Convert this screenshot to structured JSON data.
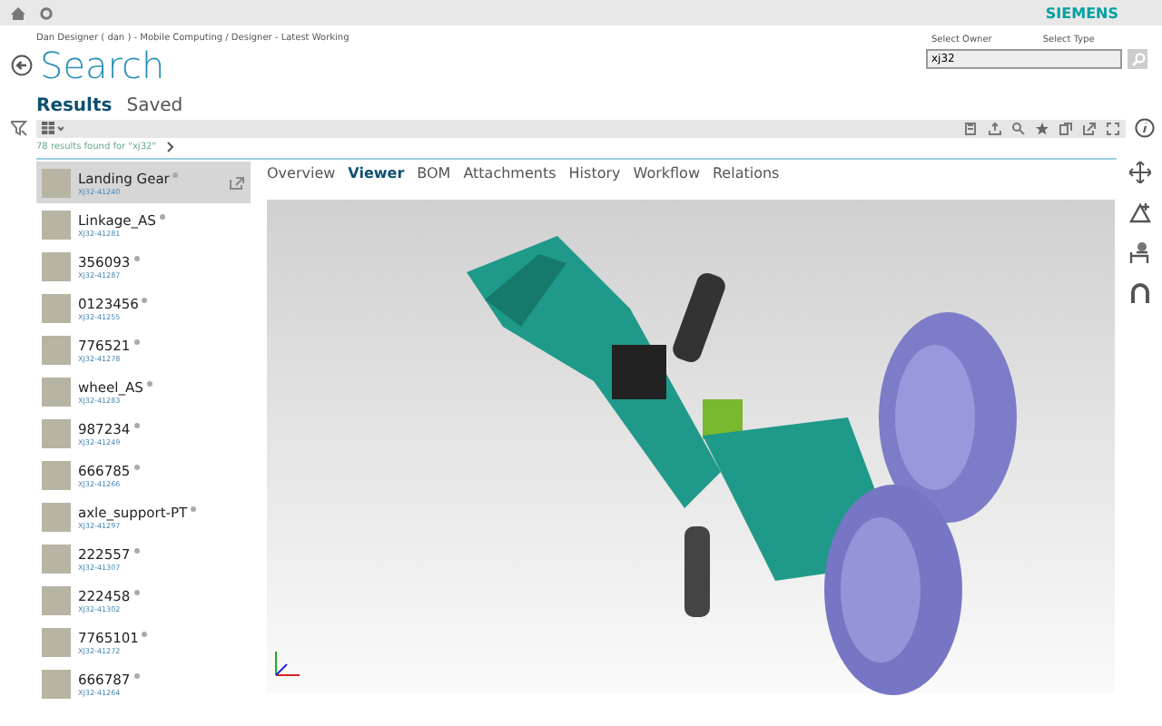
{
  "top_bar": {
    "brand": "SIEMENS"
  },
  "breadcrumb": "Dan Designer ( dan ) - Mobile Computing / Designer - Latest Working",
  "title": "Search",
  "search": {
    "owner_label": "Select Owner",
    "type_label": "Select Type",
    "value": "xj32"
  },
  "view_tabs": [
    {
      "label": "Results",
      "selected": true
    },
    {
      "label": "Saved",
      "selected": false
    }
  ],
  "results_summary": "78 results found for \"xj32\"",
  "results": [
    {
      "name": "Landing Gear",
      "id": "XJ32-41240",
      "selected": true
    },
    {
      "name": "Linkage_AS",
      "id": "XJ32-41281",
      "selected": false
    },
    {
      "name": "356093",
      "id": "XJ32-41287",
      "selected": false
    },
    {
      "name": "0123456",
      "id": "XJ32-41255",
      "selected": false
    },
    {
      "name": "776521",
      "id": "XJ32-41278",
      "selected": false
    },
    {
      "name": "wheel_AS",
      "id": "XJ32-41283",
      "selected": false
    },
    {
      "name": "987234",
      "id": "XJ32-41249",
      "selected": false
    },
    {
      "name": "666785",
      "id": "XJ32-41266",
      "selected": false
    },
    {
      "name": "axle_support-PT",
      "id": "XJ32-41297",
      "selected": false
    },
    {
      "name": "222557",
      "id": "XJ32-41307",
      "selected": false
    },
    {
      "name": "222458",
      "id": "XJ32-41302",
      "selected": false
    },
    {
      "name": "7765101",
      "id": "XJ32-41272",
      "selected": false
    },
    {
      "name": "666787",
      "id": "XJ32-41264",
      "selected": false
    }
  ],
  "detail_tabs": [
    {
      "label": "Overview",
      "selected": false
    },
    {
      "label": "Viewer",
      "selected": true
    },
    {
      "label": "BOM",
      "selected": false
    },
    {
      "label": "Attachments",
      "selected": false
    },
    {
      "label": "History",
      "selected": false
    },
    {
      "label": "Workflow",
      "selected": false
    },
    {
      "label": "Relations",
      "selected": false
    }
  ]
}
